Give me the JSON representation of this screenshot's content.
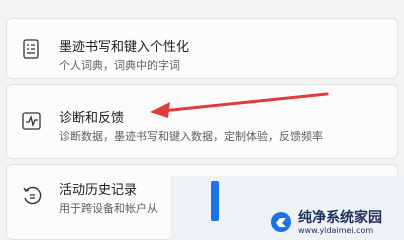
{
  "settings": {
    "items": [
      {
        "title": "墨迹书写和键入个性化",
        "subtitle": "个人词典，词典中的字词",
        "icon": "pen-list-icon"
      },
      {
        "title": "诊断和反馈",
        "subtitle": "诊断数据，墨迹书写和键入数据，定制体验，反馈频率",
        "icon": "pulse-icon"
      },
      {
        "title": "活动历史记录",
        "subtitle": "用于跨设备和帐户从",
        "icon": "history-icon"
      }
    ]
  },
  "watermark": {
    "brand": "纯净系统家园",
    "url": "www.yidaimei.com"
  },
  "colors": {
    "annotation": "#e23b3b",
    "watermark_blue": "#1a73e8"
  }
}
